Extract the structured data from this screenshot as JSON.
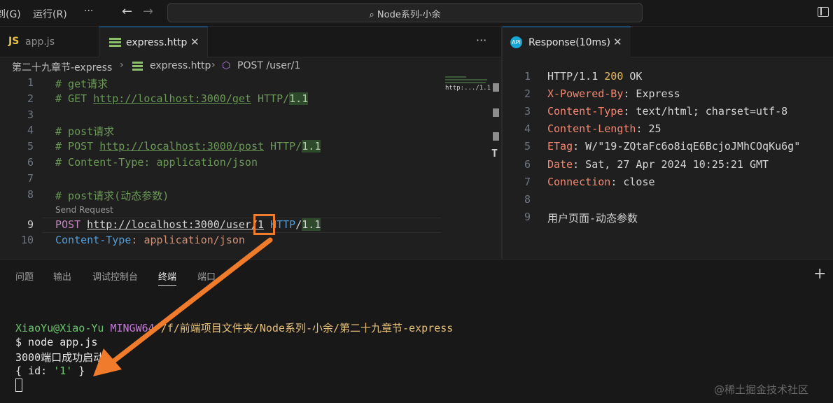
{
  "titlebar": {
    "menu_partial": "到(G)",
    "menu_run": "运行(R)",
    "more": "···",
    "back": "←",
    "forward": "→",
    "search_icon": "⌕",
    "title": "Node系列-小余"
  },
  "tabs": {
    "app": {
      "badge": "JS",
      "label": "app.js"
    },
    "express": {
      "label": "express.http",
      "close": "✕"
    },
    "more": "···"
  },
  "breadcrumb": {
    "folder": "第二十九章节-express",
    "file": "express.http",
    "request": "POST /user/1"
  },
  "editor": {
    "line_numbers": [
      "1",
      "2",
      "3",
      "4",
      "5",
      "6",
      "7",
      "8",
      "9",
      "10"
    ],
    "codelens": "Send Request",
    "lines": {
      "l1_hash": "#",
      "l1_text": " get请求",
      "l2_hash": "#",
      "l2_method": " GET ",
      "l2_url": "http://localhost:3000/get",
      "l2_ver": " HTTP/",
      "l2_num": "1.1",
      "l4_hash": "#",
      "l4_text": " post请求",
      "l5_hash": "#",
      "l5_method": " POST ",
      "l5_url": "http://localhost:3000/post",
      "l5_ver": " HTTP/",
      "l5_num": "1.1",
      "l6_hash": "#",
      "l6_text": " Content-Type: application/json",
      "l8_hash": "#",
      "l8_text": " post请求(动态参数)",
      "l9_method": "POST",
      "l9_url": "http://localhost:3000/user/",
      "l9_id": "1",
      "l9_ver": " HTTP",
      "l9_slash": "/",
      "l9_num": "1.1",
      "l10_name": "Content-Type",
      "l10_colon": ": ",
      "l10_value": "application/json"
    },
    "minimap_text": "http:.../1.1",
    "scroll_t": "T"
  },
  "response": {
    "tab_label": "Response(10ms)",
    "tab_close": "✕",
    "icon": "API",
    "line_numbers": [
      "1",
      "2",
      "3",
      "4",
      "5",
      "6",
      "7",
      "8",
      "9"
    ],
    "status_proto": "HTTP/1.1 ",
    "status_code": "200",
    "status_text": " OK",
    "headers": [
      {
        "name": "X-Powered-By",
        "value": ": Express"
      },
      {
        "name": "Content-Type",
        "value": ": text/html; charset=utf-8"
      },
      {
        "name": "Content-Length",
        "value": ": 25"
      },
      {
        "name": "ETag",
        "value": ": W/\"19-ZQtaFc6o8iqE6BcjoJMhCOqKu6g\""
      },
      {
        "name": "Date",
        "value": ": Sat, 27 Apr 2024 10:25:21 GMT"
      },
      {
        "name": "Connection",
        "value": ": close"
      }
    ],
    "body": "用户页面-动态参数"
  },
  "panel": {
    "tabs": [
      "问题",
      "输出",
      "调试控制台",
      "终端",
      "端口"
    ],
    "plus": "+",
    "terminal": {
      "user": "XiaoYu@Xiao-Yu",
      "host": "MINGW64",
      "path": "/f/前端项目文件夹/Node系列-小余/第二十九章节-express",
      "cmd": "$ node app.js",
      "out1": "3000端口成功启动",
      "obj_open": "{ id: ",
      "obj_val": "'1'",
      "obj_close": " }"
    }
  },
  "watermark": "@稀土掘金技术社区",
  "colors": {
    "arrow": "#ef7b2b",
    "accent": "#0078d4"
  }
}
